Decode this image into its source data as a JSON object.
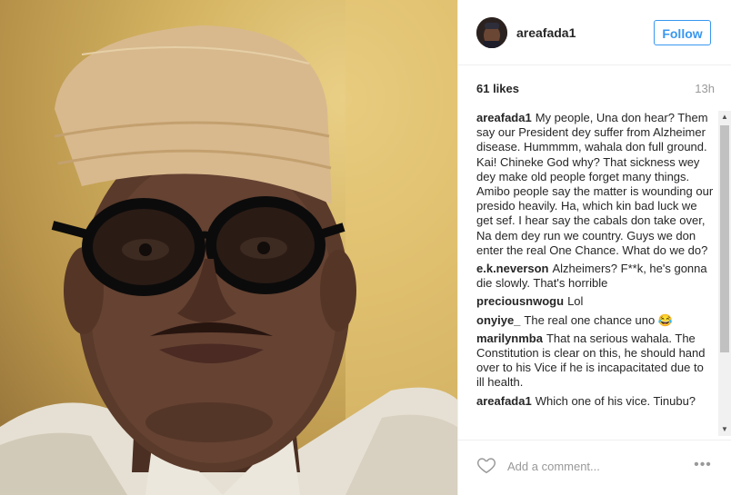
{
  "post": {
    "username": "areafada1",
    "follow_label": "Follow",
    "likes": "61 likes",
    "time": "13h"
  },
  "comments": [
    {
      "user": "areafada1",
      "text": "My people, Una don hear? Them say our President dey suffer from Alzheimer disease. Hummmm, wahala don full ground. Kai! Chineke God why? That sickness wey dey make old people forget many things. Amibo people say the matter is wounding our presido heavily. Ha, which kin bad luck we get sef. I hear say the cabals don take over, Na dem dey run we country. Guys we don enter the real One Chance. What do we do?"
    },
    {
      "user": "e.k.neverson",
      "text": "Alzheimers? F**k, he's gonna die slowly. That's horrible"
    },
    {
      "user": "preciousnwogu",
      "text": "Lol"
    },
    {
      "user": "onyiye_",
      "text": "The real one chance uno 😂"
    },
    {
      "user": "marilynmba",
      "text": "That na serious wahala. The Constitution is clear on this, he should hand over to his Vice if he is incapacitated due to ill health."
    },
    {
      "user": "areafada1",
      "text": "Which one of his vice. Tinubu?"
    }
  ],
  "footer": {
    "comment_placeholder": "Add a comment...",
    "more_label": "•••"
  },
  "icons": {
    "heart": "heart-icon",
    "more": "more-options-icon",
    "scroll_up": "scroll-up-arrow-icon",
    "scroll_down": "scroll-down-arrow-icon"
  },
  "colors": {
    "follow_blue": "#3897f0",
    "text": "#262626",
    "muted": "#999999"
  }
}
